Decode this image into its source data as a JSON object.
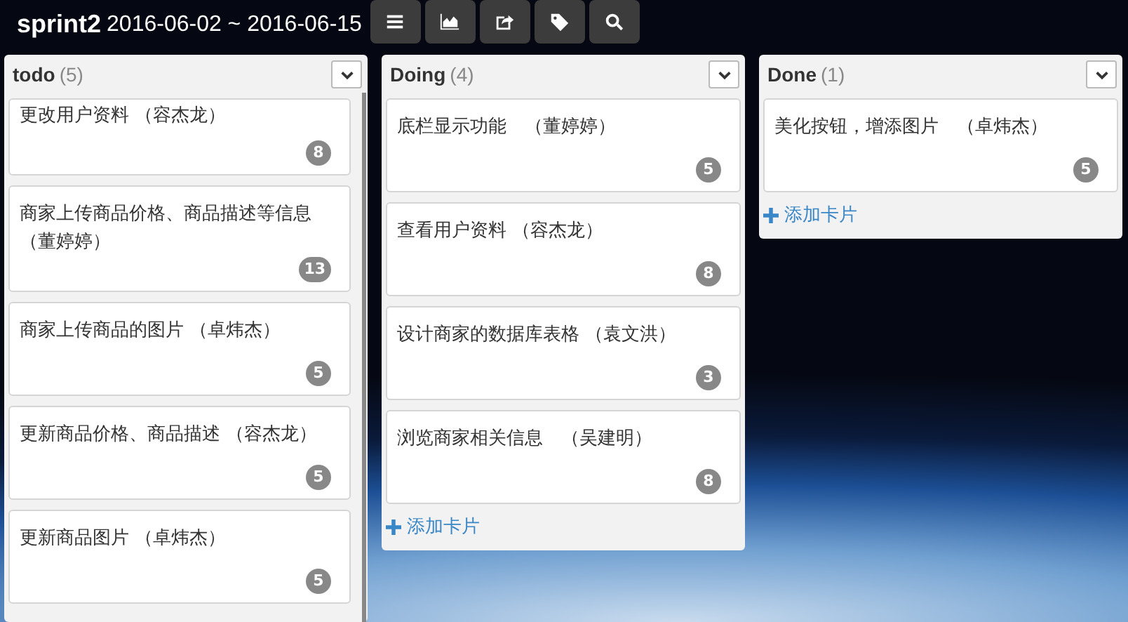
{
  "header": {
    "title": "sprint2",
    "dates": "2016-06-02 ~ 2016-06-15",
    "toolbar": [
      {
        "kind": "menu"
      },
      {
        "kind": "chart"
      },
      {
        "kind": "share"
      },
      {
        "kind": "tag"
      },
      {
        "kind": "search"
      }
    ]
  },
  "columns": [
    {
      "title": "todo",
      "count": "(5)",
      "cards": [
        {
          "text": "更改用户资料 （容杰龙）",
          "points": "8"
        },
        {
          "text": "商家上传商品价格、商品描述等信息（董婷婷）",
          "points": "13"
        },
        {
          "text": "商家上传商品的图片 （卓炜杰）",
          "points": "5"
        },
        {
          "text": "更新商品价格、商品描述 （容杰龙）",
          "points": "5"
        },
        {
          "text": "更新商品图片 （卓炜杰）",
          "points": "5"
        }
      ]
    },
    {
      "title": "Doing",
      "count": "(4)",
      "cards": [
        {
          "text": "底栏显示功能　（董婷婷）",
          "points": "5"
        },
        {
          "text": "查看用户资料 （容杰龙）",
          "points": "8"
        },
        {
          "text": "设计商家的数据库表格 （袁文洪）",
          "points": "3"
        },
        {
          "text": "浏览商家相关信息　（吴建明）",
          "points": "8"
        }
      ],
      "add_label": "添加卡片"
    },
    {
      "title": "Done",
      "count": "(1)",
      "cards": [
        {
          "text": "美化按钮，增添图片　（卓炜杰）",
          "points": "5"
        }
      ],
      "add_label": "添加卡片"
    }
  ]
}
